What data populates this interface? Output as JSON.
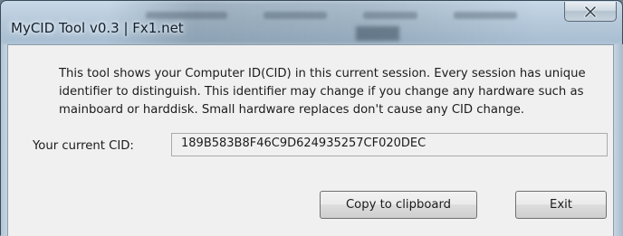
{
  "window": {
    "title": "MyCID Tool v0.3 | Fx1.net"
  },
  "close": {
    "icon": "close-icon"
  },
  "description": "This tool shows your Computer ID(CID) in this current session. Every session has unique identifier to distinguish. This identifier may change if you change any hardware such as mainboard or harddisk. Small hardware replaces don't cause any CID change.",
  "cid": {
    "label": "Your current CID:",
    "value": "189B583B8F46C9D624935257CF020DEC"
  },
  "buttons": {
    "copy_label": "Copy to clipboard",
    "exit_label": "Exit"
  }
}
